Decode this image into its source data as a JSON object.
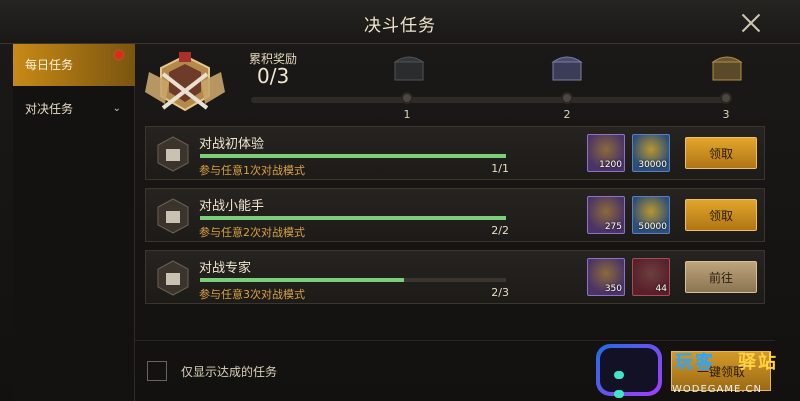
{
  "header": {
    "title": "决斗任务"
  },
  "sidebar": {
    "items": [
      {
        "label": "每日任务"
      },
      {
        "label": "对决任务"
      }
    ]
  },
  "reward_track": {
    "label": "累积奖励",
    "count": "0/3",
    "progress": 0.0,
    "nodes": [
      "1",
      "2",
      "3"
    ]
  },
  "tasks": [
    {
      "name": "对战初体验",
      "desc": "参与任意1次对战模式",
      "progress_text": "1/1",
      "progress": 1.0,
      "rewards": [
        {
          "qty": "1200"
        },
        {
          "qty": "30000"
        }
      ],
      "button": "领取"
    },
    {
      "name": "对战小能手",
      "desc": "参与任意2次对战模式",
      "progress_text": "2/2",
      "progress": 1.0,
      "rewards": [
        {
          "qty": "275"
        },
        {
          "qty": "50000"
        }
      ],
      "button": "领取"
    },
    {
      "name": "对战专家",
      "desc": "参与任意3次对战模式",
      "progress_text": "2/3",
      "progress": 0.667,
      "rewards": [
        {
          "qty": "350"
        },
        {
          "qty": "44"
        }
      ],
      "button": "前往"
    }
  ],
  "footer": {
    "checkbox_label": "仅显示达成的任务",
    "claim_all": "一键领取"
  },
  "watermark": {
    "text_a": "玩客",
    "text_b": "驿站",
    "url": "WODEGAME.CN"
  },
  "colors": {
    "accent_gold": "#c88a16",
    "progress_green": "#7ccf7a",
    "desc_orange": "#d8a247",
    "badge_red": "#e0281c"
  }
}
